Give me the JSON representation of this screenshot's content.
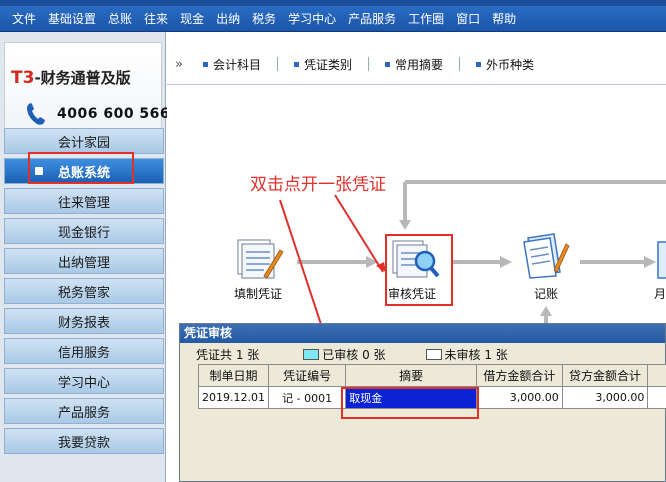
{
  "menubar": {
    "items": [
      "文件",
      "基础设置",
      "总账",
      "往来",
      "现金",
      "出纳",
      "税务",
      "学习中心",
      "产品服务",
      "工作圈",
      "窗口",
      "帮助"
    ]
  },
  "brand": {
    "t3": "T3",
    "product": "-财务通普及版",
    "phone": "4006 600 566"
  },
  "sidebar": {
    "items": [
      {
        "label": "会计家园"
      },
      {
        "label": "总账系统"
      },
      {
        "label": "往来管理"
      },
      {
        "label": "现金银行"
      },
      {
        "label": "出纳管理"
      },
      {
        "label": "税务管家"
      },
      {
        "label": "财务报表"
      },
      {
        "label": "信用服务"
      },
      {
        "label": "学习中心"
      },
      {
        "label": "产品服务"
      },
      {
        "label": "我要贷款"
      }
    ]
  },
  "toolbar": {
    "chevron": "»",
    "items": [
      "会计科目",
      "凭证类别",
      "常用摘要",
      "外币种类"
    ]
  },
  "flow": {
    "fill": "填制凭证",
    "review": "审核凭证",
    "post": "记账",
    "month_partial": "月"
  },
  "annotation": {
    "text": "双击点开一张凭证"
  },
  "dialog": {
    "title": "凭证审核",
    "total": "凭证共 1 张",
    "reviewed": "已审核 0 张",
    "unreviewed": "未审核 1 张",
    "columns": [
      "制单日期",
      "凭证编号",
      "摘要",
      "借方金额合计",
      "贷方金额合计"
    ],
    "rows": [
      {
        "date": "2019.12.01",
        "number": "记 - 0001",
        "summary": "取现金",
        "debit": "3,000.00",
        "credit": "3,000.00"
      }
    ]
  },
  "colors": {
    "menubar": "#1b56a8",
    "active_nav": "#1c5fb3",
    "annotation": "#e0302a",
    "selection": "#0a24d6",
    "reviewed_swatch": "#7fe8f2"
  }
}
